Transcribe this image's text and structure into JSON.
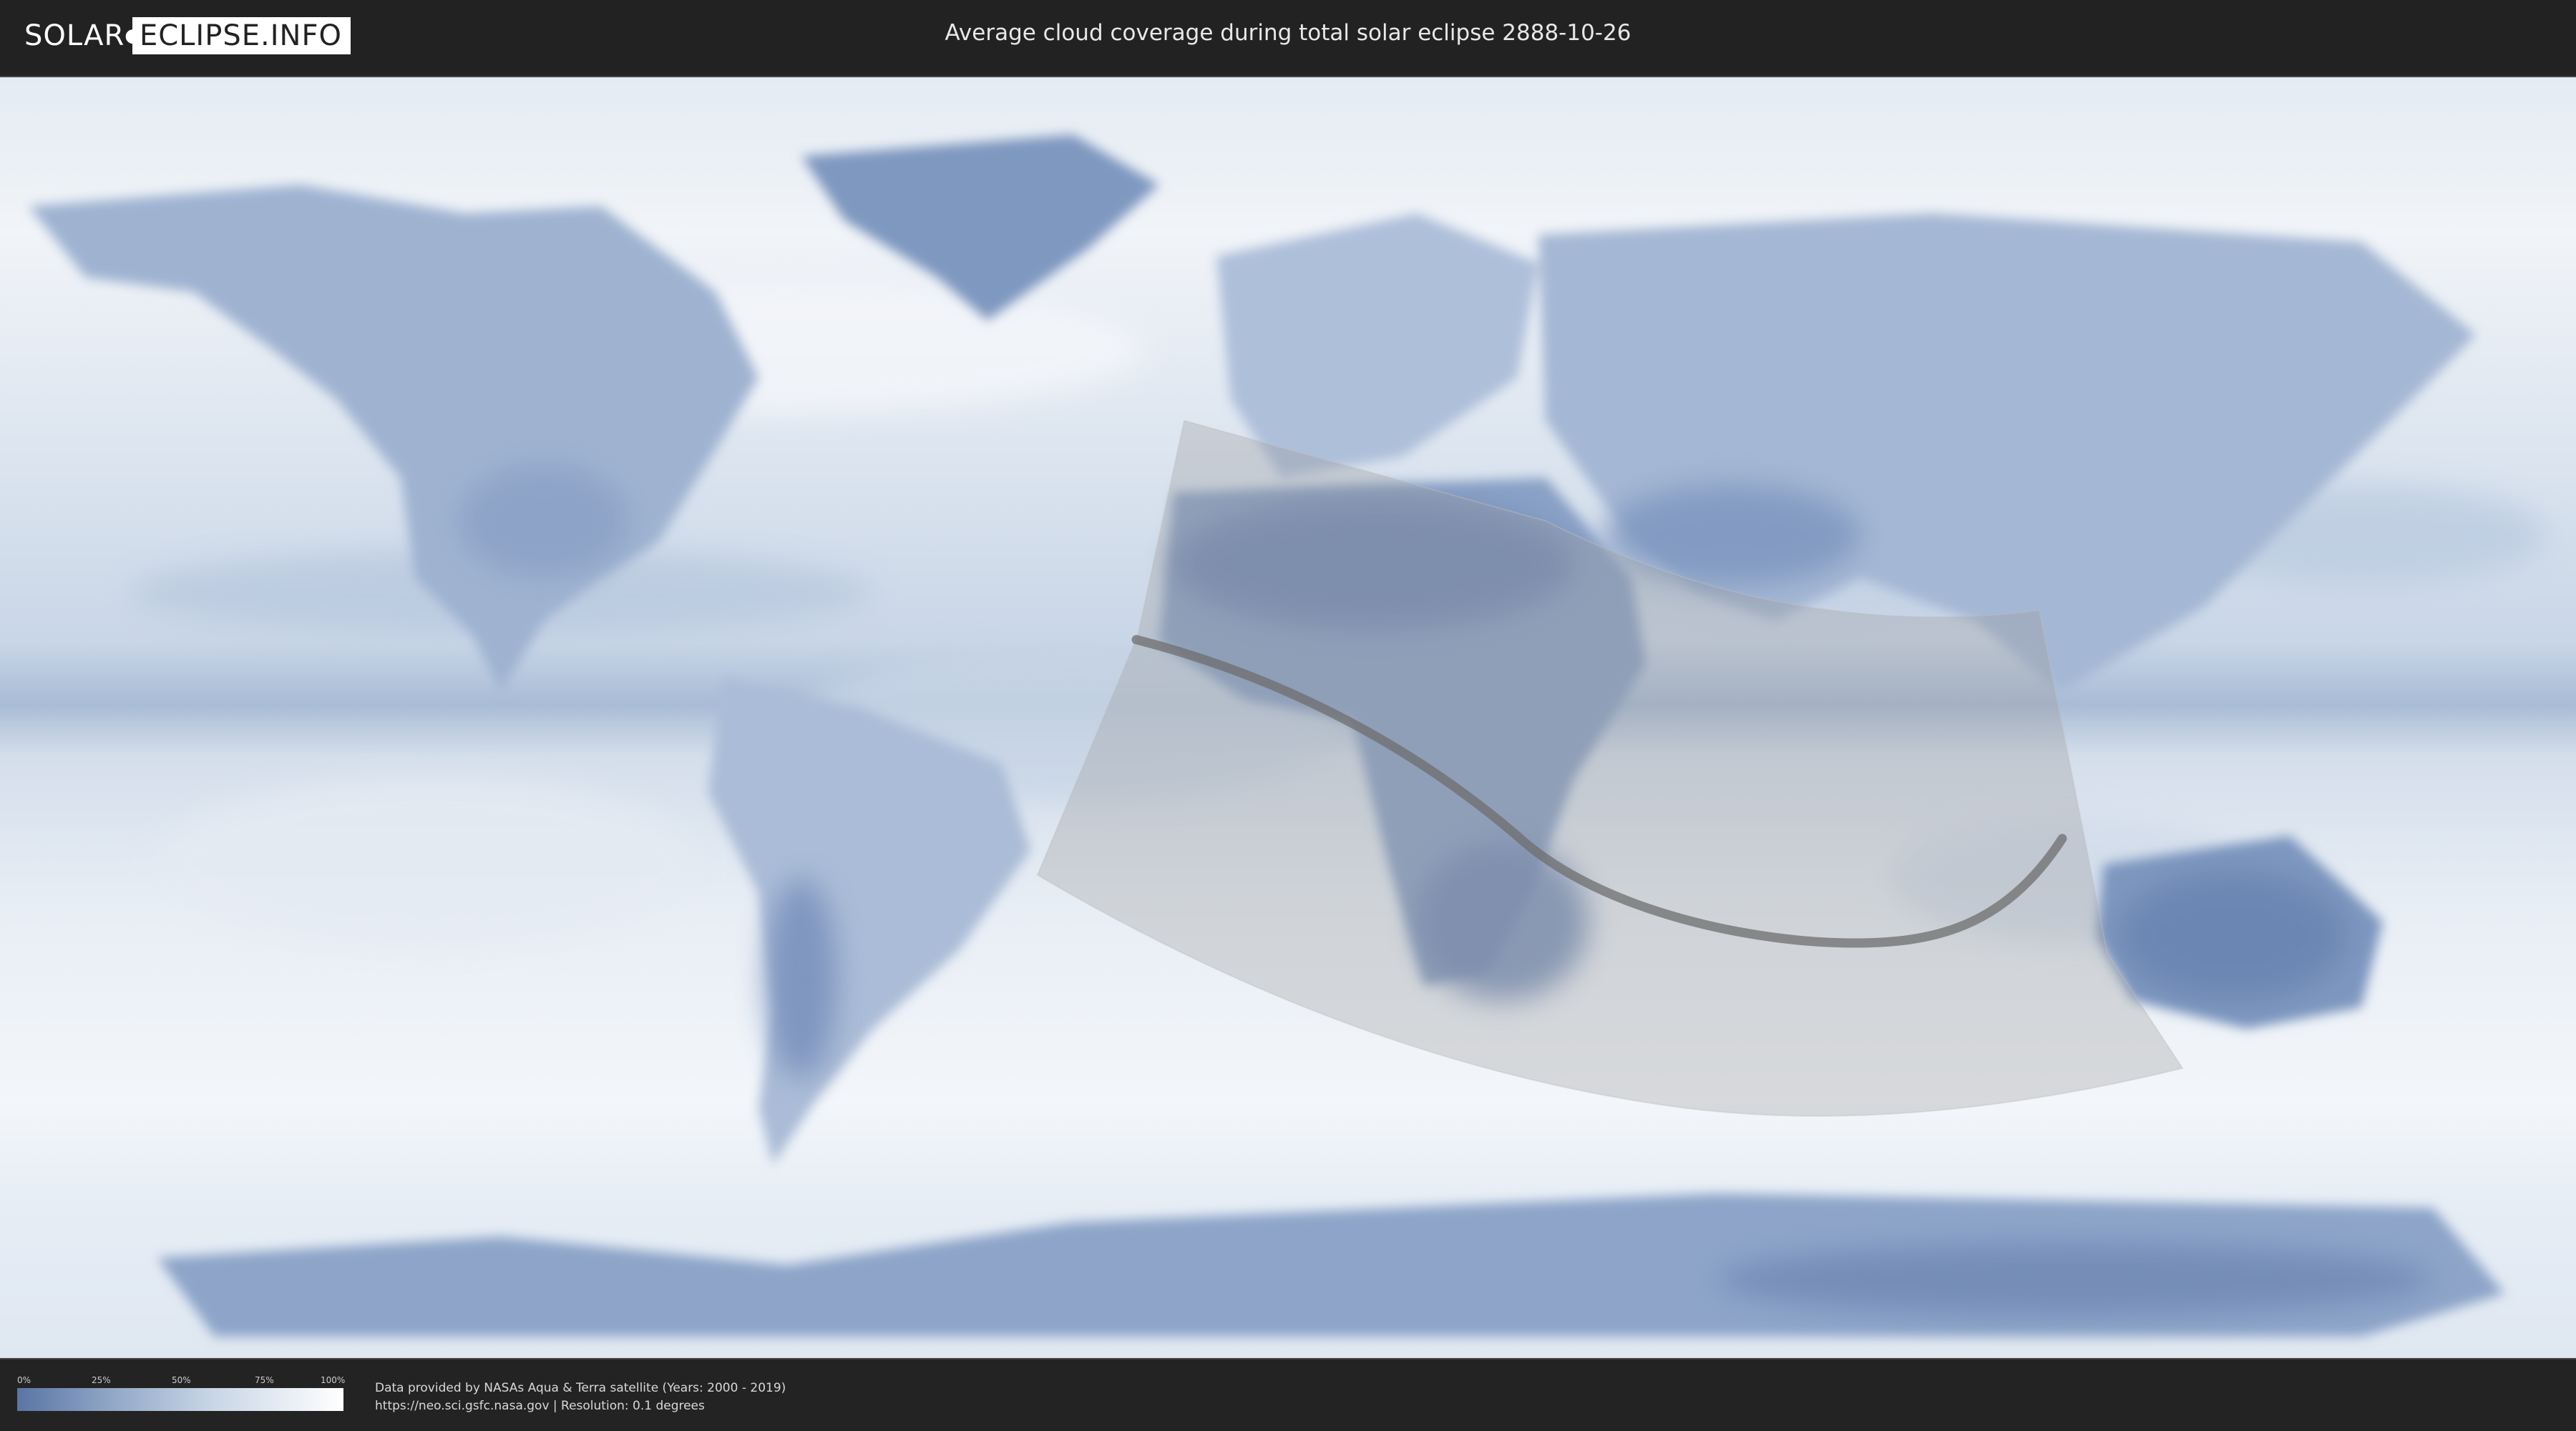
{
  "header": {
    "logo_left": "SOLAR",
    "logo_right": "ECLIPSE.INFO",
    "title": "Average cloud coverage during total solar eclipse 2888-10-26"
  },
  "legend": {
    "ticks": [
      "0%",
      "25%",
      "50%",
      "75%",
      "100%"
    ]
  },
  "footer": {
    "credit_line": "Data provided by NASAs Aqua & Terra satellite (Years: 2000 - 2019)",
    "source_line": "https://neo.sci.gsfc.nasa.gov | Resolution: 0.1 degrees"
  },
  "colors": {
    "clear_sky": "#5a75a5",
    "overcast": "#ffffff",
    "eclipse_region": "#9a9a9a",
    "totality_path": "#6e6e6e"
  }
}
